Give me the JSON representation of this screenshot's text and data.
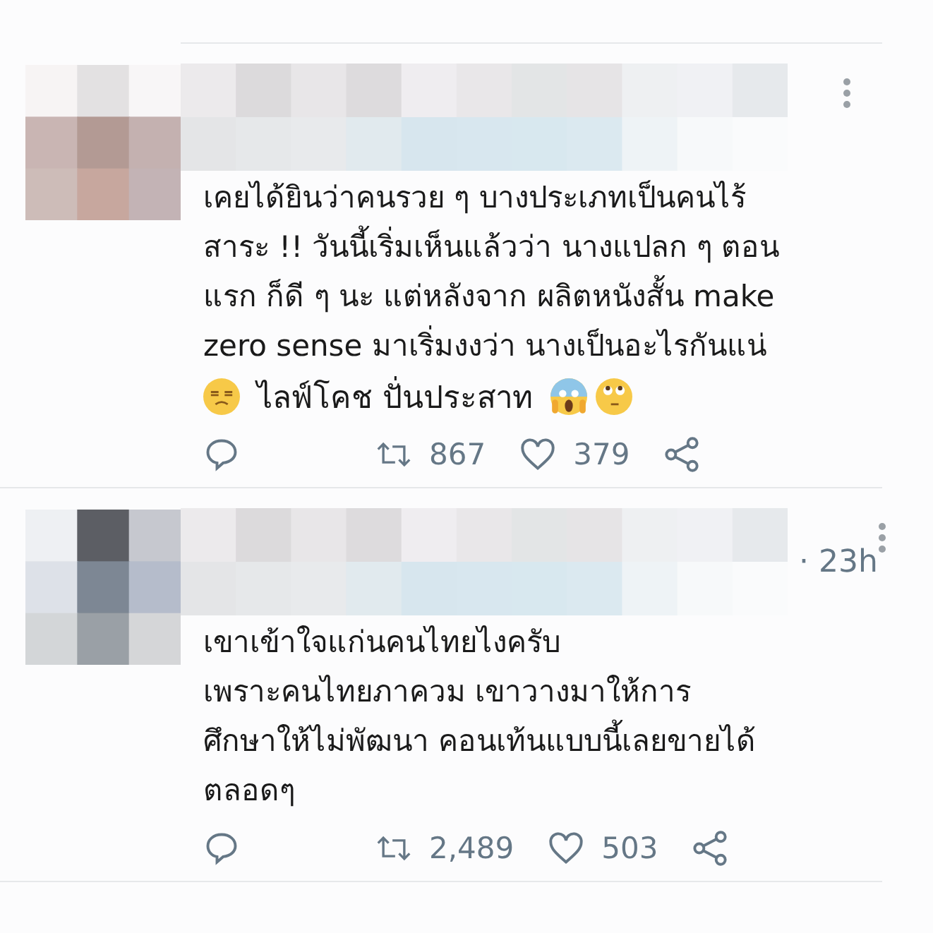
{
  "replies": [
    {
      "body": "เคยได้ยินว่าคนรวย ๆ บางประเภทเป็นคนไร้\nสาระ !! วันนี้เริ่มเห็นแล้วว่า นางแปลก ๆ ตอน\nแรก ก็ดี ๆ นะ แต่หลังจาก ผลิตหนังสั้น make\nzero sense มาเริ่มงงว่า นางเป็นอะไรกันแน่",
      "tail": "ไลฟ์โคช ปั่นประสาท",
      "retweets": "867",
      "likes": "379"
    },
    {
      "time": "· 23h",
      "body": "เขาเข้าใจแก่นคนไทยไงครับ\nเพราะคนไทยภาควม เขาวางมาให้การ\nศึกษาให้ไม่พัฒนา คอนเท้นแบบนี้เลยขายได้\nตลอดๆ",
      "retweets": "2,489",
      "likes": "503"
    }
  ]
}
